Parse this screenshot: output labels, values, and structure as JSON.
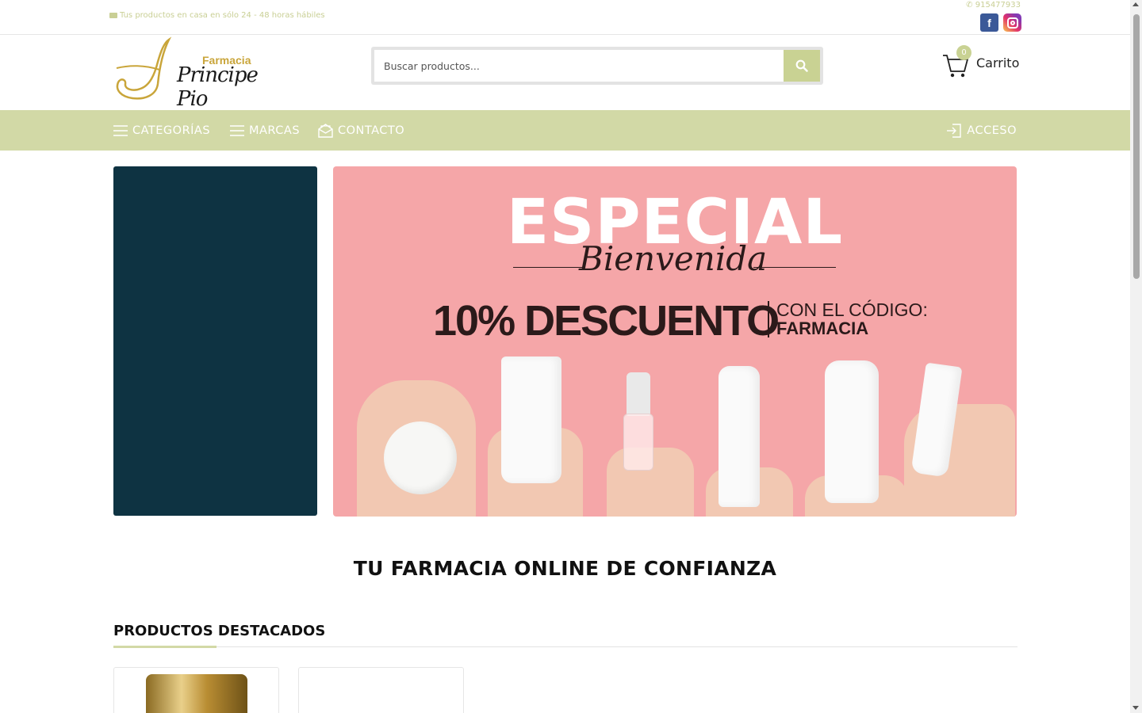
{
  "topbar": {
    "shipping_text": "Tus productos en casa en sólo 24 - 48 horas hábiles",
    "phone": "915477933",
    "social": [
      "facebook-icon",
      "instagram-icon"
    ]
  },
  "header": {
    "logo_small": "Farmacia",
    "logo_name": "Principe Pio",
    "search_placeholder": "Buscar productos...",
    "cart_label": "Carrito",
    "cart_count": "0"
  },
  "nav": {
    "categories": "CATEGORÍAS",
    "brands": "MARCAS",
    "contact": "CONTACTO",
    "login": "ACCESO"
  },
  "promo": {
    "title": "ESPECIAL",
    "subtitle": "Bienvenida",
    "discount": "10% DESCUENTO",
    "code_label": "CON EL CÓDIGO:",
    "code": "FARMACIA"
  },
  "main": {
    "tagline": "TU FARMACIA ONLINE DE CONFIANZA",
    "featured_heading": "PRODUCTOS DESTACADOS"
  },
  "colors": {
    "accent": "#d2d9a6",
    "accent_text": "#c9cf95",
    "dark_panel": "#0e3342",
    "promo_bg": "#f5a6a8"
  }
}
